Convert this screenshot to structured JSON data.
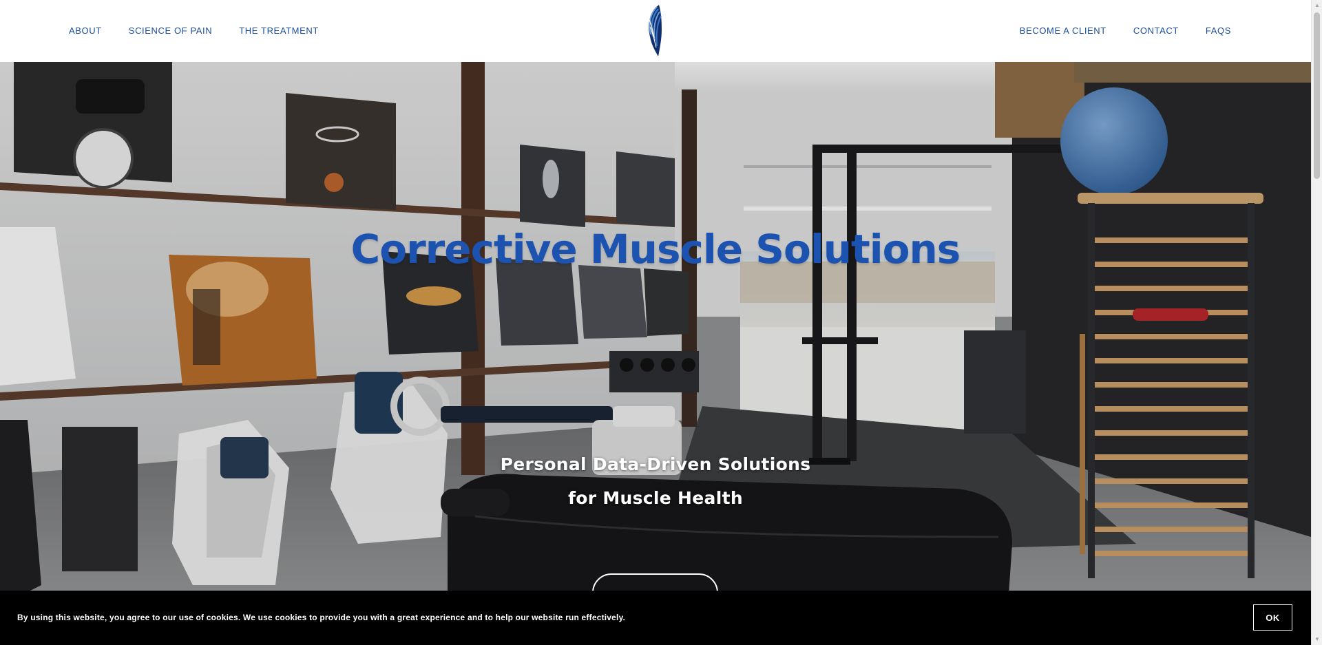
{
  "nav": {
    "left": [
      {
        "label": "ABOUT"
      },
      {
        "label": "SCIENCE OF PAIN"
      },
      {
        "label": "THE TREATMENT"
      }
    ],
    "right": [
      {
        "label": "BECOME A CLIENT"
      },
      {
        "label": "CONTACT"
      },
      {
        "label": "FAQS"
      }
    ],
    "logo_icon": "feather-logo-icon",
    "link_color": "#1b4c9a"
  },
  "hero": {
    "title": "Corrective Muscle Solutions",
    "subtitle_line1": "Personal Data-Driven Solutions",
    "subtitle_line2": "for Muscle Health",
    "title_color": "#1d53b0",
    "background_photo": "gym-interior-photo"
  },
  "cookie_banner": {
    "text": "By using this website, you agree to our use of cookies. We use cookies to provide you with a great experience and to help our website run effectively.",
    "ok_label": "OK"
  }
}
